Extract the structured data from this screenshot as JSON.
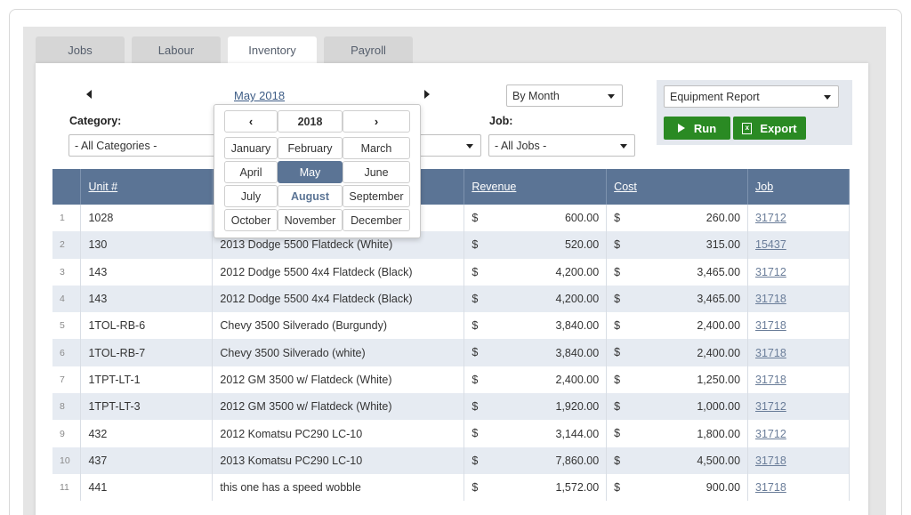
{
  "tabs": [
    {
      "label": "Jobs"
    },
    {
      "label": "Labour"
    },
    {
      "label": "Inventory"
    },
    {
      "label": "Payroll"
    }
  ],
  "period": {
    "label": "May 2018"
  },
  "filters": {
    "period_type": "By Month",
    "category_label": "Category:",
    "category_value": "- All Categories -",
    "job_label": "Job:",
    "job_value": "- All Jobs -"
  },
  "report": {
    "selected": "Equipment Report",
    "run_label": "Run",
    "export_label": "Export"
  },
  "calendar": {
    "year": "2018",
    "prev_icon": "chevron-left-icon",
    "next_icon": "chevron-right-icon",
    "months": [
      "January",
      "February",
      "March",
      "April",
      "May",
      "June",
      "July",
      "August",
      "September",
      "October",
      "November",
      "December"
    ],
    "selected_month": "May",
    "current_month": "August"
  },
  "table": {
    "headers": {
      "unit": "Unit #",
      "revenue": "Revenue",
      "cost": "Cost",
      "job": "Job"
    },
    "currency": "$",
    "rows": [
      {
        "n": "1",
        "unit": "1028",
        "desc": "",
        "revenue": "600.00",
        "cost": "260.00",
        "job": "31712"
      },
      {
        "n": "2",
        "unit": "130",
        "desc": "2013 Dodge 5500 Flatdeck (White)",
        "revenue": "520.00",
        "cost": "315.00",
        "job": "15437"
      },
      {
        "n": "3",
        "unit": "143",
        "desc": "2012 Dodge 5500 4x4 Flatdeck (Black)",
        "revenue": "4,200.00",
        "cost": "3,465.00",
        "job": "31712"
      },
      {
        "n": "4",
        "unit": "143",
        "desc": "2012 Dodge 5500 4x4 Flatdeck (Black)",
        "revenue": "4,200.00",
        "cost": "3,465.00",
        "job": "31718"
      },
      {
        "n": "5",
        "unit": "1TOL-RB-6",
        "desc": "Chevy 3500 Silverado (Burgundy)",
        "revenue": "3,840.00",
        "cost": "2,400.00",
        "job": "31718"
      },
      {
        "n": "6",
        "unit": "1TOL-RB-7",
        "desc": "Chevy 3500 Silverado (white)",
        "revenue": "3,840.00",
        "cost": "2,400.00",
        "job": "31718"
      },
      {
        "n": "7",
        "unit": "1TPT-LT-1",
        "desc": "2012 GM 3500 w/ Flatdeck (White)",
        "revenue": "2,400.00",
        "cost": "1,250.00",
        "job": "31718"
      },
      {
        "n": "8",
        "unit": "1TPT-LT-3",
        "desc": "2012 GM 3500 w/ Flatdeck (White)",
        "revenue": "1,920.00",
        "cost": "1,000.00",
        "job": "31712"
      },
      {
        "n": "9",
        "unit": "432",
        "desc": "2012 Komatsu PC290 LC-10",
        "revenue": "3,144.00",
        "cost": "1,800.00",
        "job": "31712"
      },
      {
        "n": "10",
        "unit": "437",
        "desc": "2013 Komatsu PC290 LC-10",
        "revenue": "7,860.00",
        "cost": "4,500.00",
        "job": "31718"
      },
      {
        "n": "11",
        "unit": "441",
        "desc": "this one has a speed wobble",
        "revenue": "1,572.00",
        "cost": "900.00",
        "job": "31718"
      }
    ]
  },
  "colors": {
    "header": "#5b7495",
    "button_green": "#2a8a23",
    "row_alt": "#e6ebf2",
    "link": "#3e5d86"
  }
}
